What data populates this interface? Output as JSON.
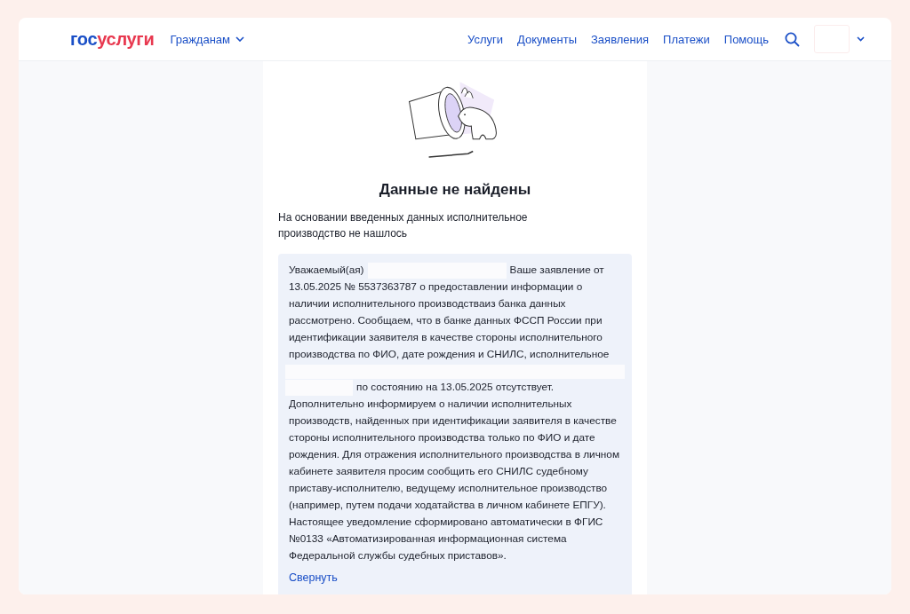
{
  "header": {
    "logo": [
      {
        "text": "гос",
        "color": "#1a4fc7"
      },
      {
        "text": "услуги",
        "color": "#e8384f"
      }
    ],
    "menu": {
      "label": "Гражданам"
    },
    "nav": [
      "Услуги",
      "Документы",
      "Заявления",
      "Платежи",
      "Помощь"
    ]
  },
  "result": {
    "title": "Данные не найдены",
    "description": "На основании введенных данных исполнительное производство не нашлось",
    "message": [
      {
        "kind": "inline",
        "text": "Уважаемый(ая)"
      },
      {
        "kind": "redacted"
      },
      {
        "kind": "inline",
        "text": "Ваше заявление от"
      },
      {
        "kind": "block",
        "text": "13.05.2025 № 5537363787 о предоставлении информации о наличии исполнительного производстваиз банка данных рассмотрено. Сообщаем, что в банке данных ФССП России при идентификации заявителя в качестве стороны исполнительного производства по ФИО, дате рождения и СНИЛС, исполнительное"
      },
      {
        "kind": "redacted-line"
      },
      {
        "kind": "redacted"
      },
      {
        "kind": "inline",
        "text": "по состоянию на 13.05.2025 отсутствует."
      },
      {
        "kind": "block",
        "text": "Дополнительно информируем о наличии исполнительных производств, найденных при идентификации заявителя в качестве стороны исполнительного производства только по ФИО и дате рождения. Для отражения исполнительного производства в личном кабинете заявителя просим сообщить его СНИЛС судебному приставу-исполнителю, ведущему исполнительное производство (например, путем подачи ходатайства в личном кабинете ЕПГУ). Настоящее уведомление сформировано автоматически в ФГИС №0133 «Автоматизированная информационная система Федеральной службы судебных приставов»."
      }
    ],
    "collapse_link": "Свернуть"
  }
}
